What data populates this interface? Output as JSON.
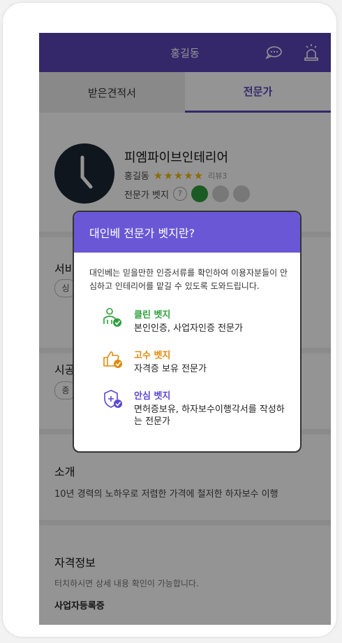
{
  "topbar": {
    "title": "홍길동",
    "chat_icon": "chat-icon",
    "alarm_icon": "siren-icon"
  },
  "tabs": [
    {
      "label": "받은견적서"
    },
    {
      "label": "전문가"
    }
  ],
  "profile": {
    "company": "피엠파이브인테리어",
    "owner": "홍길동",
    "stars": "★★★★★",
    "review": "리뷰3",
    "badge_label": "전문가 벳지",
    "question_mark": "?"
  },
  "sections": {
    "service_title": "서비",
    "service_tag": "싱",
    "construction_title": "시공",
    "construction_tag": "종",
    "intro_title": "소개",
    "intro_text": "10년 경력의 노하우로 저렴한 가격에 철저한 하자보수 이행",
    "license_title": "자격정보",
    "license_hint": "터치하시면 상세 내용 확인이 가능합니다.",
    "license_item": "사업자등록증"
  },
  "modal": {
    "title": "대인베 전문가 벳지란?",
    "description": "대인베는 믿을만한 인증서류를 확인하여 이용자분들이 안심하고 인테리어를 맡길 수 있도록 도와드립니다.",
    "badges": [
      {
        "name": "클린 벳지",
        "desc": "본인인증, 사업자인증 전문가",
        "color": "#2e9e3e"
      },
      {
        "name": "고수 벳지",
        "desc": "자격증 보유 전문가",
        "color": "#e08a0b"
      },
      {
        "name": "안심 벳지",
        "desc": "면허증보유, 하자보수이행각서를 작성하는 전문가",
        "color": "#5a48d0"
      }
    ]
  }
}
